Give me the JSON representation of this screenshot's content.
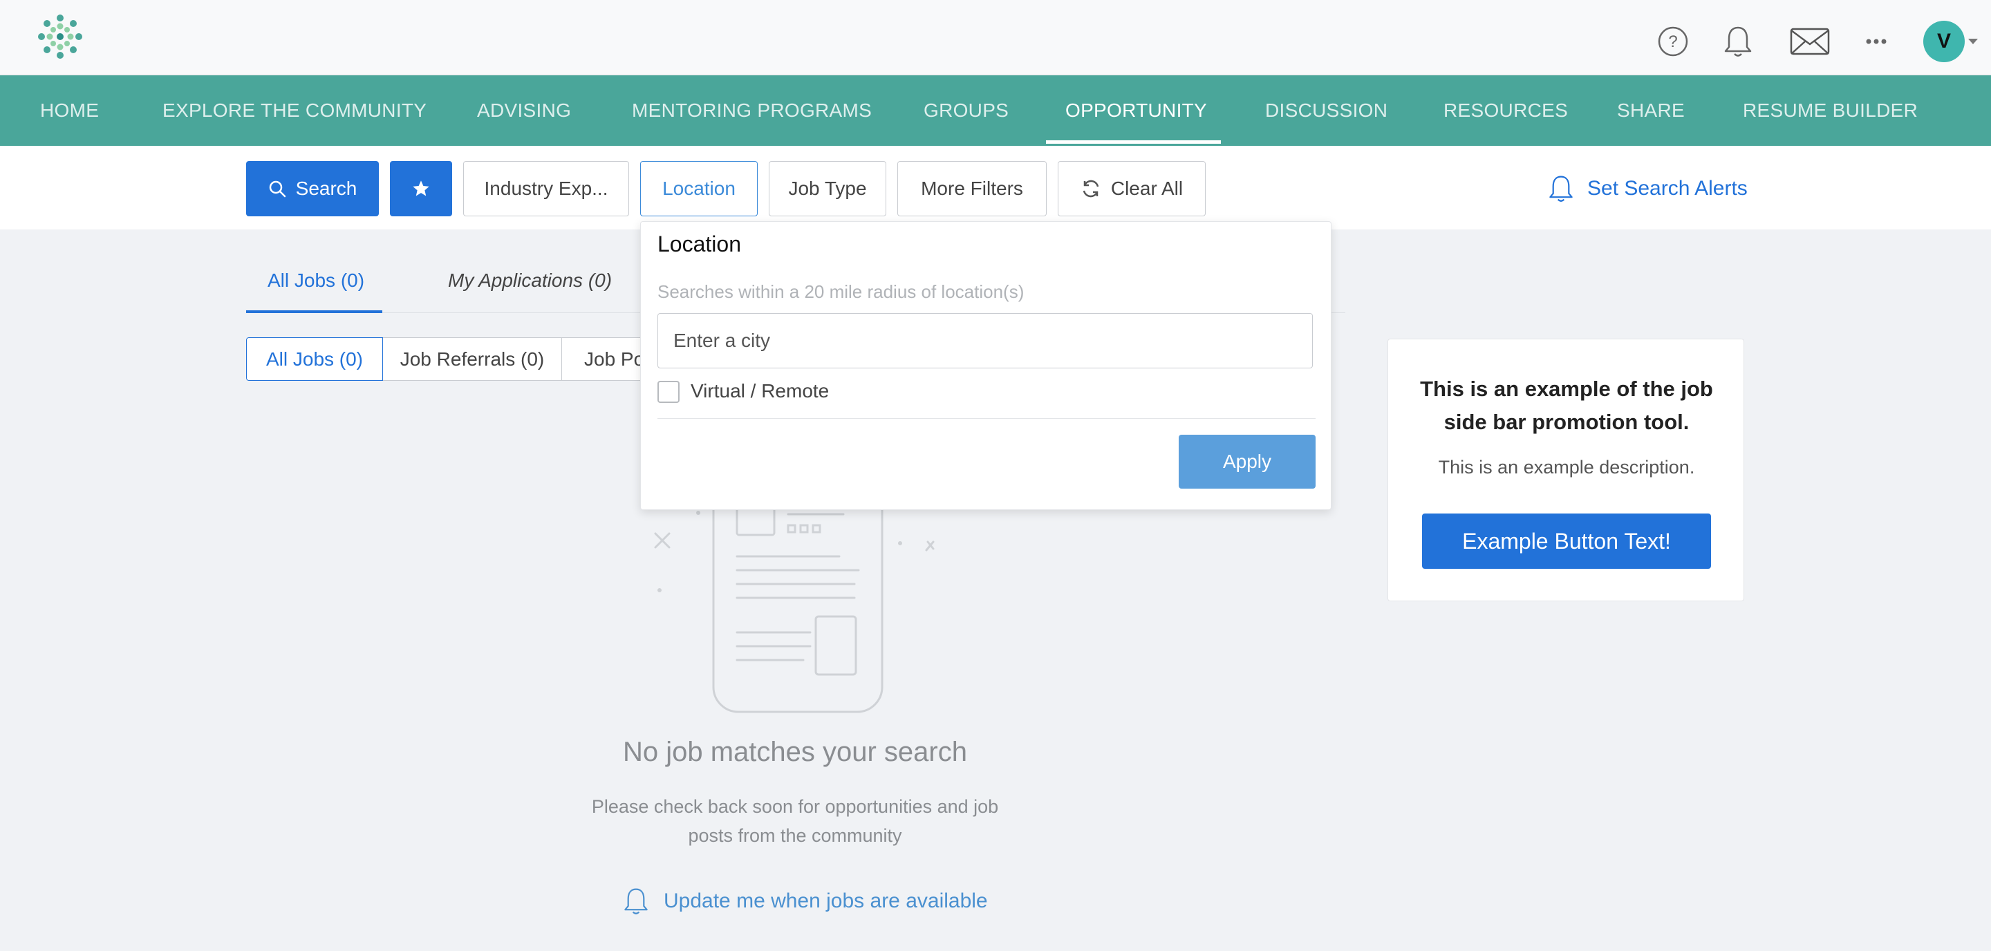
{
  "header": {
    "logo_icon": "flower-logo-icon",
    "icons": [
      "help-icon",
      "bell-icon",
      "mail-icon",
      "more-icon"
    ],
    "avatar_initial": "V"
  },
  "nav": {
    "items": [
      {
        "label": "HOME"
      },
      {
        "label": "EXPLORE THE COMMUNITY"
      },
      {
        "label": "ADVISING"
      },
      {
        "label": "MENTORING PROGRAMS"
      },
      {
        "label": "GROUPS"
      },
      {
        "label": "OPPORTUNITY"
      },
      {
        "label": "DISCUSSION"
      },
      {
        "label": "RESOURCES"
      },
      {
        "label": "SHARE"
      },
      {
        "label": "RESUME BUILDER"
      }
    ],
    "active": "OPPORTUNITY",
    "color": "#4aa69a"
  },
  "filters": {
    "search_label": "Search",
    "industry_label": "Industry Exp...",
    "location_label": "Location",
    "job_type_label": "Job Type",
    "more_filters_label": "More Filters",
    "clear_all_label": "Clear All",
    "alerts_label": "Set Search Alerts"
  },
  "tabs": {
    "all_jobs": "All Jobs (0)",
    "my_applications": "My Applications (0)"
  },
  "segments": {
    "all_jobs": "All Jobs (0)",
    "job_referrals": "Job Referrals (0)",
    "job_posts": "Job Po"
  },
  "location_dropdown": {
    "title": "Location",
    "hint": "Searches within a 20 mile radius of location(s)",
    "input_placeholder": "Enter a city",
    "remote_label": "Virtual / Remote",
    "apply_label": "Apply"
  },
  "empty_state": {
    "title": "No job matches your search",
    "description": "Please check back soon for opportunities and job posts from the community",
    "update_link": "Update me when jobs are available"
  },
  "promo": {
    "title": "This is an example of the job side bar promotion tool.",
    "description": "This is an example description.",
    "button_label": "Example Button Text!"
  },
  "colors": {
    "primary": "#2272d9",
    "teal": "#4aa69a",
    "apply": "#5b9fdc"
  }
}
